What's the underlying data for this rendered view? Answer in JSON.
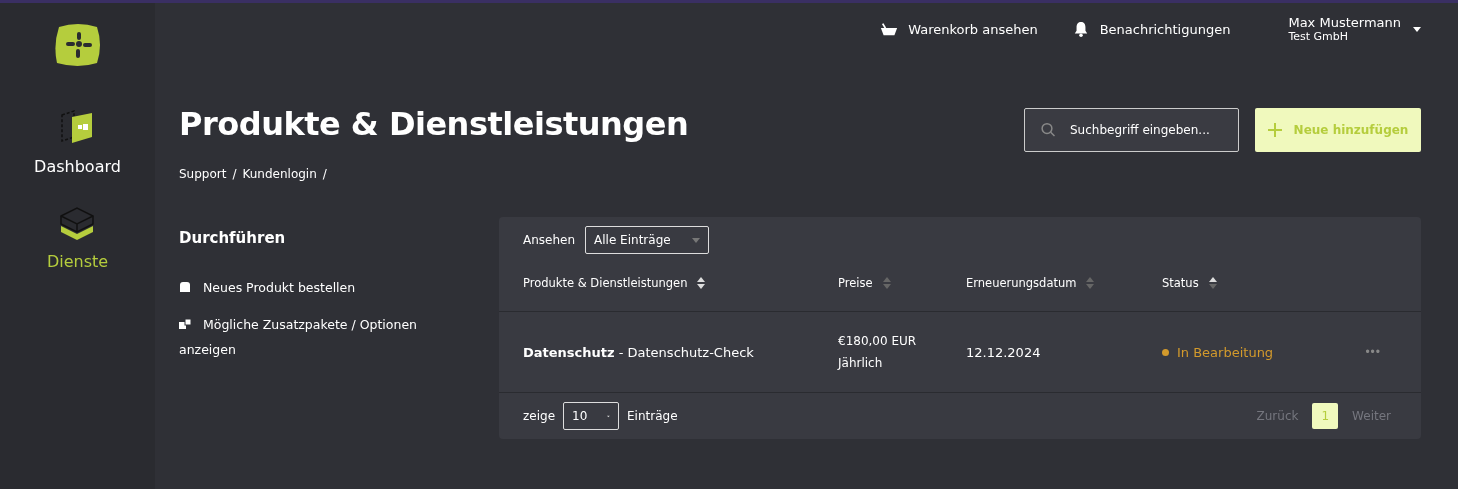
{
  "sidebar": {
    "items": [
      {
        "label": "Dashboard",
        "kind": "dashboard",
        "selected": false
      },
      {
        "label": "Dienste",
        "kind": "services",
        "selected": true
      }
    ]
  },
  "topbar": {
    "cart": "Warenkorb ansehen",
    "notifications": "Benachrichtigungen",
    "user": {
      "name": "Max Mustermann",
      "company": "Test GmbH"
    }
  },
  "page": {
    "title": "Produkte & Dienstleistungen",
    "breadcrumb": [
      {
        "label": "Support",
        "separator": "/"
      },
      {
        "label": "Kundenlogin",
        "separator": "/"
      }
    ],
    "search": {
      "placeholder": "Suchbegriff eingeben..."
    },
    "add_button": "Neue hinzufügen"
  },
  "actions": {
    "title": "Durchführen",
    "items": [
      {
        "label": "Neues Produkt bestellen",
        "kind": "order"
      },
      {
        "label": "Mögliche Zusatzpakete / Optionen anzeigen",
        "kind": "addons"
      }
    ]
  },
  "table": {
    "view_label": "Ansehen",
    "view_value": "Alle Einträge",
    "columns": [
      {
        "label": "Produkte & Dienstleistungen",
        "sortable": true,
        "sorted": false
      },
      {
        "label": "Preise",
        "sortable": false,
        "sorted": false
      },
      {
        "label": "Erneuerungsdatum",
        "sortable": false,
        "sorted": false
      },
      {
        "label": "Status",
        "sortable": true,
        "sorted": true
      }
    ],
    "rows": [
      {
        "product": "**Datenschutz** - Datenschutz-Check",
        "price": "€180,00 EUR",
        "cycle": "Jährlich",
        "date": "12.12.2024",
        "status": "In Bearbeitung",
        "color": "#d39a2c",
        "menu": "•••"
      }
    ],
    "footer": {
      "show_label": "zeige",
      "page_size": "10",
      "entries_label": "Einträge",
      "pages": [
        {
          "label": "Zurück",
          "disabled": true,
          "selected": false
        },
        {
          "label": "1",
          "disabled": false,
          "selected": true
        },
        {
          "label": "Weiter",
          "disabled": true,
          "selected": false
        }
      ]
    }
  }
}
